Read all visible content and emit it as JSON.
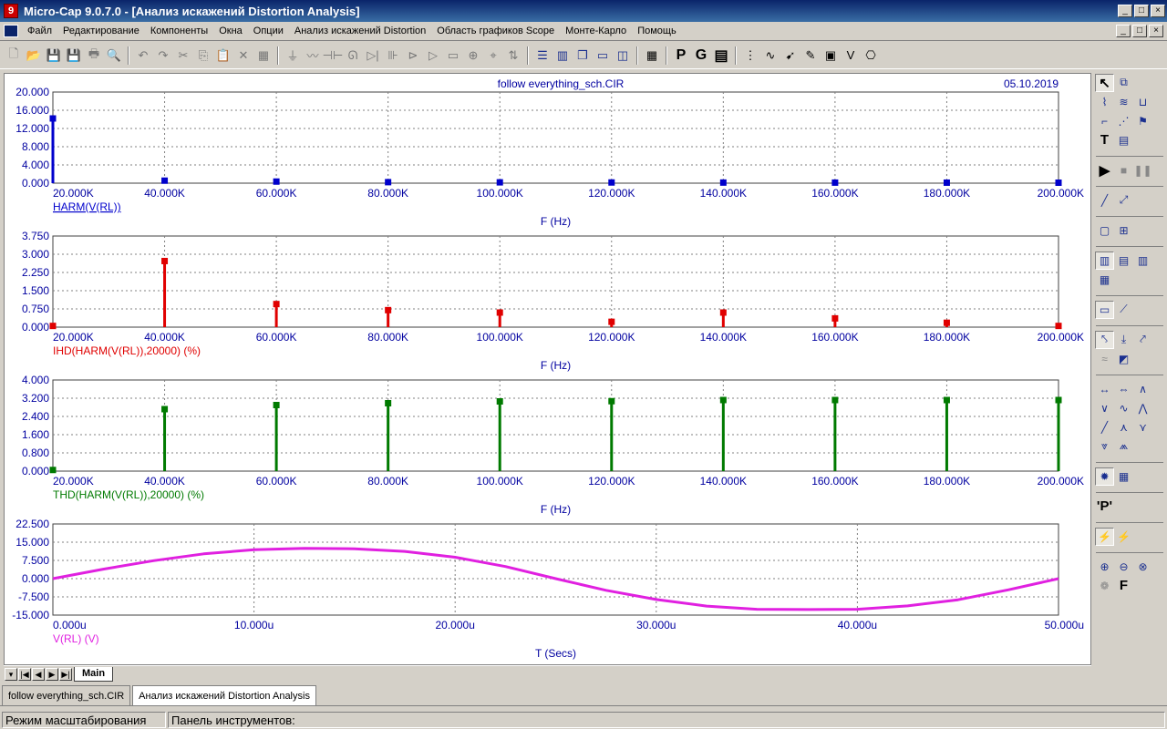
{
  "window": {
    "title": "Micro-Cap 9.0.7.0 - [Анализ искажений Distortion Analysis]",
    "app_icon_glyph": "9",
    "controls": [
      "_",
      "□",
      "×"
    ]
  },
  "menu": {
    "items": [
      "Файл",
      "Редактирование",
      "Компоненты",
      "Окна",
      "Опции",
      "Анализ искажений Distortion",
      "Область графиков Scope",
      "Монте-Карло",
      "Помощь"
    ],
    "mdi_controls": [
      "_",
      "□",
      "×"
    ]
  },
  "toolbar": {
    "groups": [
      [
        "new-icon",
        "open-icon",
        "save-icon",
        "save-all-icon",
        "print-icon",
        "print-preview-icon"
      ],
      [
        "undo-icon",
        "redo-icon",
        "cut-icon",
        "copy-icon",
        "paste-icon",
        "delete-icon",
        "select-all-icon"
      ],
      [
        "ground-icon",
        "resistor-icon",
        "capacitor-icon",
        "inductor-icon",
        "diode-icon",
        "battery-icon",
        "npn-icon",
        "opamp-icon",
        "macro-icon",
        "source-icon",
        "probe-icon",
        "switch-icon"
      ],
      [
        "tile-horizontal-icon",
        "tile-vertical-icon",
        "cascade-icon",
        "window-icon",
        "split-icon"
      ],
      [
        "calculator-icon"
      ],
      [
        "page-scale-icon",
        "graph-scale-icon",
        "table-icon"
      ],
      [
        "data-points-icon",
        "tokens-icon",
        "probe-tool-icon",
        "pen-icon",
        "preferences-icon",
        "value-icon",
        "info-icon"
      ]
    ],
    "glyphs": {
      "new-icon": "🗋",
      "open-icon": "📂",
      "save-icon": "💾",
      "save-all-icon": "💾",
      "print-icon": "🖶",
      "print-preview-icon": "🔍",
      "undo-icon": "↶",
      "redo-icon": "↷",
      "cut-icon": "✂",
      "copy-icon": "⎘",
      "paste-icon": "📋",
      "delete-icon": "✕",
      "select-all-icon": "▦",
      "ground-icon": "⏚",
      "resistor-icon": "〰",
      "capacitor-icon": "⊣⊢",
      "inductor-icon": "ᘏ",
      "diode-icon": "▷|",
      "battery-icon": "⊪",
      "npn-icon": "⊳",
      "opamp-icon": "▷",
      "macro-icon": "▭",
      "source-icon": "⊕",
      "probe-icon": "⌖",
      "switch-icon": "⇅",
      "tile-horizontal-icon": "☰",
      "tile-vertical-icon": "▥",
      "cascade-icon": "❐",
      "window-icon": "▭",
      "split-icon": "◫",
      "calculator-icon": "▦",
      "page-scale-icon": "P",
      "graph-scale-icon": "G",
      "table-icon": "▤",
      "data-points-icon": "⋮",
      "tokens-icon": "∿",
      "probe-tool-icon": "➹",
      "pen-icon": "✎",
      "preferences-icon": "▣",
      "value-icon": "V",
      "info-icon": "⎔"
    }
  },
  "header": {
    "file_name": "follow everything_sch.CIR",
    "date": "05.10.2019"
  },
  "colors": {
    "harm": "#0000cc",
    "ihd": "#e00000",
    "thd": "#007a00",
    "vrl": "#e020e0",
    "axis_text": "#0000a0",
    "grid": "#808080"
  },
  "chart_data": [
    {
      "type": "bar",
      "title": "",
      "x": [
        20000,
        40000,
        60000,
        80000,
        100000,
        120000,
        140000,
        160000,
        180000,
        200000
      ],
      "values": [
        14.2,
        0.55,
        0.35,
        0.22,
        0.18,
        0.15,
        0.13,
        0.12,
        0.11,
        0.1
      ],
      "xlim": [
        20000,
        200000
      ],
      "ylim": [
        0,
        20
      ],
      "y_ticks": [
        "0.000",
        "4.000",
        "8.000",
        "12.000",
        "16.000",
        "20.000"
      ],
      "x_ticks": [
        "20.000K",
        "40.000K",
        "60.000K",
        "80.000K",
        "100.000K",
        "120.000K",
        "140.000K",
        "160.000K",
        "180.000K",
        "200.000K"
      ],
      "series_label": "HARM(V(RL))",
      "xlabel": "F (Hz)",
      "color_key": "harm",
      "grid": true
    },
    {
      "type": "bar",
      "title": "",
      "x": [
        20000,
        40000,
        60000,
        80000,
        100000,
        120000,
        140000,
        160000,
        180000,
        200000
      ],
      "values": [
        0.05,
        2.72,
        0.95,
        0.7,
        0.6,
        0.22,
        0.6,
        0.36,
        0.18,
        0.05
      ],
      "xlim": [
        20000,
        200000
      ],
      "ylim": [
        0,
        3.75
      ],
      "y_ticks": [
        "0.000",
        "0.750",
        "1.500",
        "2.250",
        "3.000",
        "3.750"
      ],
      "x_ticks": [
        "20.000K",
        "40.000K",
        "60.000K",
        "80.000K",
        "100.000K",
        "120.000K",
        "140.000K",
        "160.000K",
        "180.000K",
        "200.000K"
      ],
      "series_label": "IHD(HARM(V(RL)),20000) (%)",
      "xlabel": "F (Hz)",
      "color_key": "ihd",
      "grid": true
    },
    {
      "type": "bar",
      "title": "",
      "x": [
        20000,
        40000,
        60000,
        80000,
        100000,
        120000,
        140000,
        160000,
        180000,
        200000
      ],
      "values": [
        0.05,
        2.72,
        2.9,
        2.98,
        3.06,
        3.07,
        3.12,
        3.12,
        3.12,
        3.12
      ],
      "xlim": [
        20000,
        200000
      ],
      "ylim": [
        0,
        4
      ],
      "y_ticks": [
        "0.000",
        "0.800",
        "1.600",
        "2.400",
        "3.200",
        "4.000"
      ],
      "x_ticks": [
        "20.000K",
        "40.000K",
        "60.000K",
        "80.000K",
        "100.000K",
        "120.000K",
        "140.000K",
        "160.000K",
        "180.000K",
        "200.000K"
      ],
      "series_label": "THD(HARM(V(RL)),20000) (%)",
      "xlabel": "F (Hz)",
      "color_key": "thd",
      "grid": true
    },
    {
      "type": "line",
      "title": "",
      "x": [
        0,
        2.5,
        5,
        7.5,
        10,
        12.5,
        15,
        17.5,
        20,
        22.5,
        25,
        27.5,
        30,
        32.5,
        35,
        37.5,
        40,
        42.5,
        45,
        47.5,
        50
      ],
      "values": [
        0,
        3.9,
        7.4,
        10.2,
        11.9,
        12.5,
        12.3,
        11.2,
        8.8,
        5.0,
        0,
        -4.8,
        -8.6,
        -11.3,
        -12.6,
        -12.7,
        -12.6,
        -11.2,
        -8.7,
        -4.6,
        0
      ],
      "xlim": [
        0,
        50
      ],
      "ylim": [
        -15,
        22.5
      ],
      "y_ticks": [
        "-15.000",
        "-7.500",
        "0.000",
        "7.500",
        "15.000",
        "22.500"
      ],
      "x_ticks": [
        "0.000u",
        "10.000u",
        "20.000u",
        "30.000u",
        "40.000u",
        "50.000u"
      ],
      "series_label": "V(RL) (V)",
      "xlabel": "T (Secs)",
      "color_key": "vrl",
      "grid": true
    }
  ],
  "sidebar": {
    "rows": [
      [
        "select-mode-icon",
        "component-mode-icon"
      ],
      [
        "wire-mode-icon",
        "bus-mode-icon",
        "trace-mode-icon"
      ],
      [
        "text-mode-icon",
        "graphics-mode-icon",
        "flag-mode-icon"
      ],
      [
        "title-mode-icon",
        "info-mode-icon"
      ],
      [
        "gap"
      ],
      [
        "run-icon",
        "stop-icon",
        "pause-icon"
      ],
      [
        "gap"
      ],
      [
        "line-icon",
        "line-point-icon"
      ],
      [
        "gap"
      ],
      [
        "frame-icon",
        "grid-icon"
      ],
      [
        "gap"
      ],
      [
        "minor-grid-icon",
        "major-grid-icon",
        "grid-text-icon"
      ],
      [
        "axis-grid-icon"
      ],
      [
        "gap"
      ],
      [
        "baseline-icon",
        "horizontal-icon"
      ],
      [
        "gap"
      ],
      [
        "cursor-left-icon",
        "cursor-down-icon",
        "cursor-right-icon"
      ],
      [
        "track-icon",
        "scale-icon"
      ],
      [
        "gap"
      ],
      [
        "peak-icon",
        "valley-icon",
        "high-icon"
      ],
      [
        "low-icon",
        "inflection-icon",
        "top-icon"
      ],
      [
        "bottom-icon",
        "global-high-icon",
        "global-low-icon"
      ],
      [
        "slope-icon",
        "point-icon"
      ],
      [
        "gap"
      ],
      [
        "add-text-icon",
        "table-view-icon"
      ],
      [
        "gap"
      ],
      [
        "plot-label-icon"
      ],
      [
        "gap"
      ],
      [
        "probe-left-icon",
        "probe-right-icon"
      ],
      [
        "gap"
      ],
      [
        "zoom-in-icon",
        "zoom-out-icon",
        "zoom-box-icon"
      ],
      [
        "color-icon",
        "font-icon"
      ]
    ],
    "glyphs": {
      "select-mode-icon": "↖",
      "component-mode-icon": "⧉",
      "wire-mode-icon": "⌇",
      "bus-mode-icon": "≋",
      "trace-mode-icon": "⊔",
      "text-mode-icon": "⌐",
      "graphics-mode-icon": "⋰",
      "flag-mode-icon": "⚑",
      "title-mode-icon": "T",
      "info-mode-icon": "▤",
      "run-icon": "▶",
      "stop-icon": "■",
      "pause-icon": "❚❚",
      "line-icon": "╱",
      "line-point-icon": "⤢",
      "frame-icon": "▢",
      "grid-icon": "⊞",
      "minor-grid-icon": "▥",
      "major-grid-icon": "▤",
      "grid-text-icon": "▥",
      "axis-grid-icon": "▦",
      "baseline-icon": "▭",
      "horizontal-icon": "⟋",
      "cursor-left-icon": "⤣",
      "cursor-down-icon": "⤓",
      "cursor-right-icon": "⤤",
      "track-icon": "≈",
      "scale-icon": "◩",
      "peak-icon": "↔",
      "valley-icon": "⇔",
      "high-icon": "∧",
      "low-icon": "∨",
      "inflection-icon": "∿",
      "top-icon": "⋀",
      "bottom-icon": "╱",
      "global-high-icon": "⋏",
      "global-low-icon": "⋎",
      "slope-icon": "⩔",
      "point-icon": "⩕",
      "add-text-icon": "✹",
      "table-view-icon": "▦",
      "plot-label-icon": "'P'",
      "probe-left-icon": "⚡",
      "probe-right-icon": "⚡",
      "zoom-in-icon": "⊕",
      "zoom-out-icon": "⊖",
      "zoom-box-icon": "⊗",
      "color-icon": "❁",
      "font-icon": "F"
    },
    "pressed": [
      "select-mode-icon",
      "minor-grid-icon",
      "baseline-icon",
      "cursor-left-icon",
      "add-text-icon",
      "probe-left-icon"
    ]
  },
  "sheet_tabs": {
    "nav": [
      "▾",
      "|◀",
      "◀",
      "▶",
      "▶|"
    ],
    "active": "Main"
  },
  "doc_tabs": [
    "follow everything_sch.CIR",
    "Анализ искажений Distortion Analysis"
  ],
  "status": {
    "mode": "Режим масштабирования",
    "panel": "Панель инструментов:"
  }
}
